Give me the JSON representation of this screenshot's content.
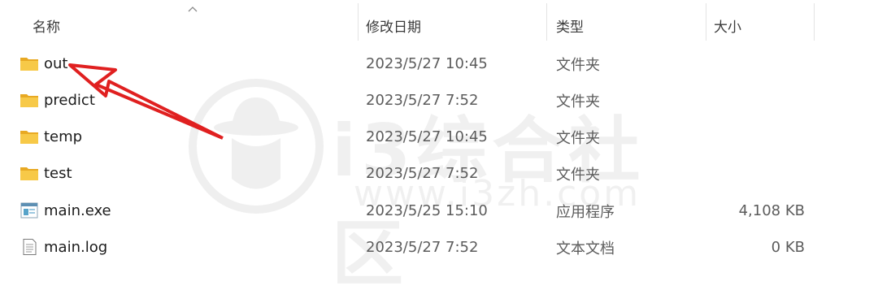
{
  "columns": {
    "name": "名称",
    "date": "修改日期",
    "type": "类型",
    "size": "大小"
  },
  "files": [
    {
      "name": "out",
      "date": "2023/5/27 10:45",
      "type": "文件夹",
      "size": "",
      "icon": "folder-icon"
    },
    {
      "name": "predict",
      "date": "2023/5/27 7:52",
      "type": "文件夹",
      "size": "",
      "icon": "folder-icon"
    },
    {
      "name": "temp",
      "date": "2023/5/27 10:45",
      "type": "文件夹",
      "size": "",
      "icon": "folder-icon"
    },
    {
      "name": "test",
      "date": "2023/5/27 7:52",
      "type": "文件夹",
      "size": "",
      "icon": "folder-icon"
    },
    {
      "name": "main.exe",
      "date": "2023/5/25 15:10",
      "type": "应用程序",
      "size": "4,108 KB",
      "icon": "exe-icon"
    },
    {
      "name": "main.log",
      "date": "2023/5/27 7:52",
      "type": "文本文档",
      "size": "0 KB",
      "icon": "text-document-icon"
    }
  ],
  "watermark": {
    "text": "i3综合社区",
    "url": "www.i3zh.com"
  },
  "colors": {
    "folder": "#f5c342",
    "annotation_arrow": "#e02020"
  }
}
